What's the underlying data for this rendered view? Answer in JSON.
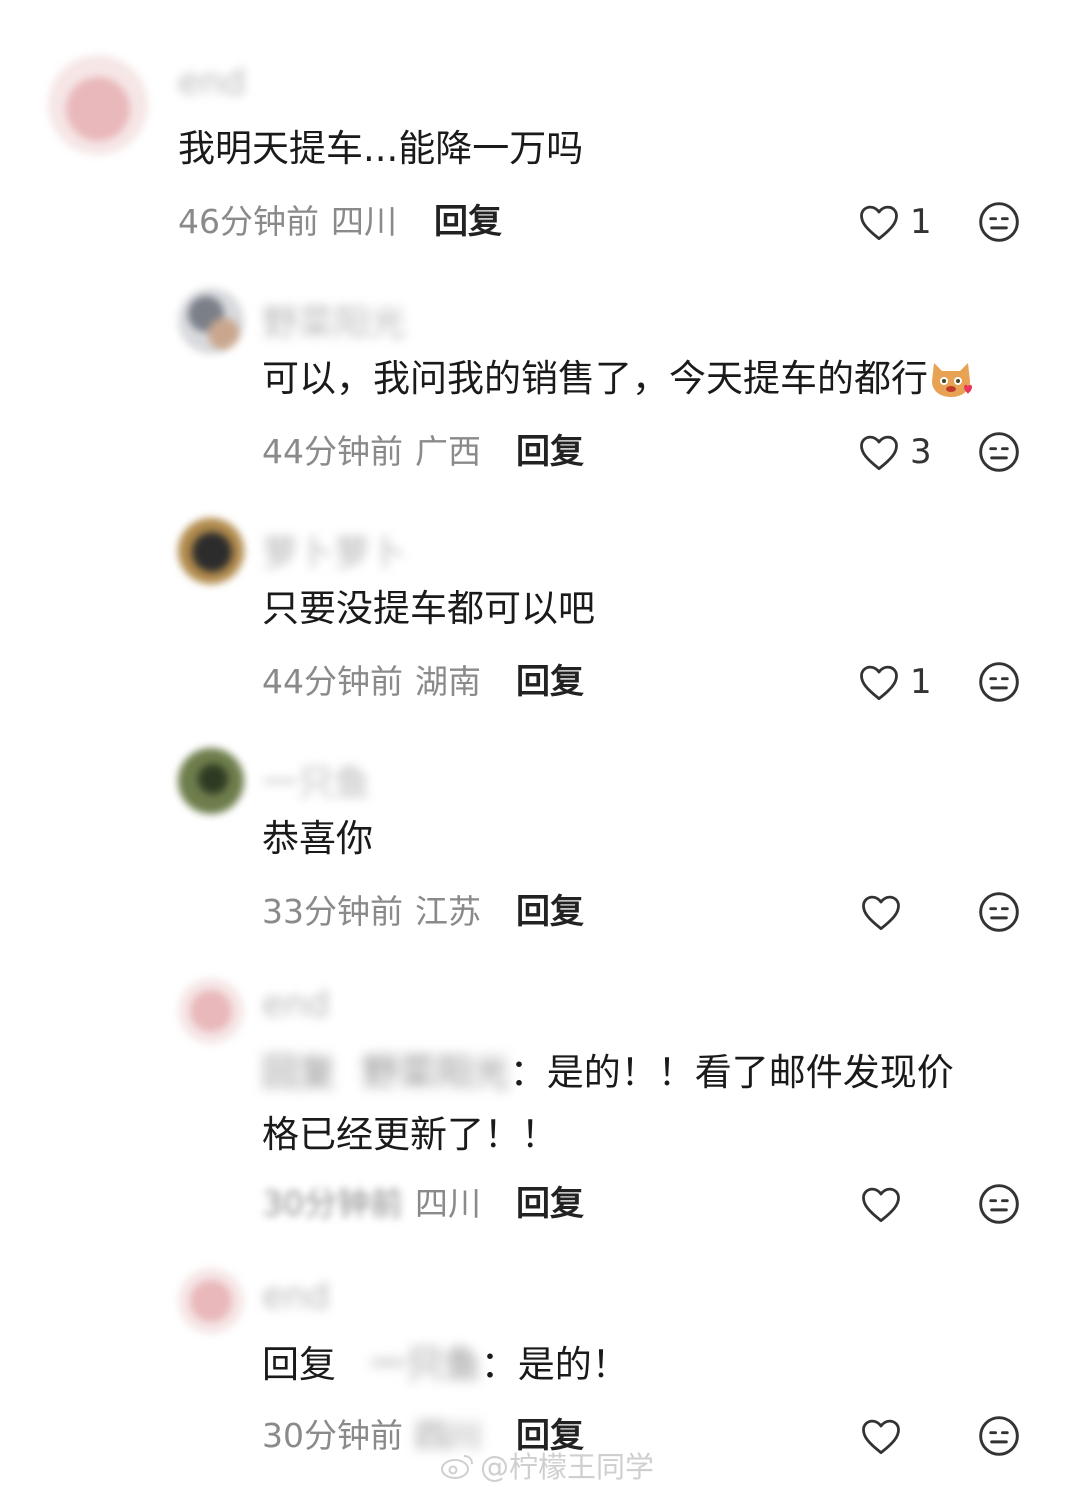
{
  "comments": [
    {
      "username": "end",
      "text": "我明天提车...能降一万吗",
      "time": "46分钟前",
      "region": "四川",
      "reply": "回复",
      "likes": "1"
    },
    {
      "username": "野菜阳光",
      "text": "可以，我问我的销售了，今天提车的都行",
      "time": "44分钟前",
      "region": "广西",
      "reply": "回复",
      "likes": "3"
    },
    {
      "username": "萝卜萝卜",
      "text": "只要没提车都可以吧",
      "time": "44分钟前",
      "region": "湖南",
      "reply": "回复",
      "likes": "1"
    },
    {
      "username": "一只鱼",
      "text": "恭喜你",
      "time": "33分钟前",
      "region": "江苏",
      "reply": "回复",
      "likes": ""
    },
    {
      "username": "end",
      "reply_prefix": "回复",
      "reply_target": "野菜阳光",
      "text_line1": "：是的！！看了邮件发现价",
      "text_line2": "格已经更新了！！",
      "time": "30分钟前",
      "region": "四川",
      "reply": "回复",
      "likes": ""
    },
    {
      "username": "end",
      "reply_prefix": "回复",
      "reply_target": "一只鱼",
      "text": "：是的！",
      "time": "30分钟前",
      "region": "四川",
      "reply": "回复",
      "likes": ""
    }
  ],
  "watermark": "@柠檬王同学",
  "icons": {
    "like": "heart-outline-icon",
    "dislike": "neutral-face-icon",
    "emoji": "cat-heart-emoji"
  },
  "colors": {
    "text": "#1a1a1a",
    "meta": "#8a8a8a",
    "username": "#b8b8b8"
  }
}
